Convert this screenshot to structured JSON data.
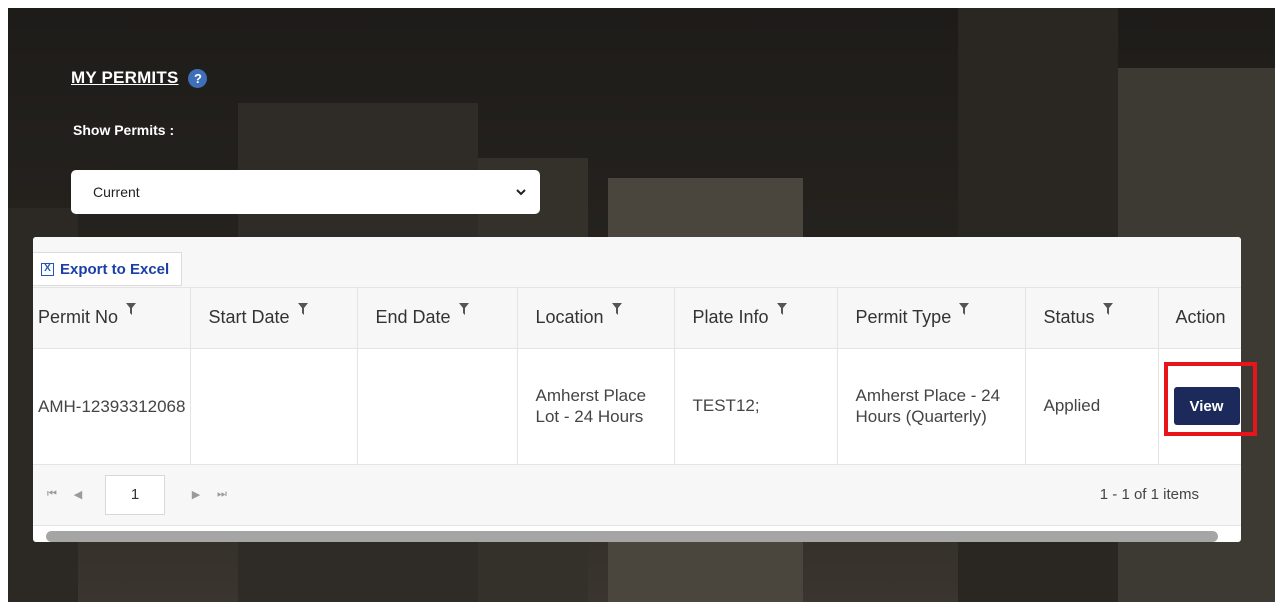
{
  "page": {
    "title": "MY PERMITS",
    "help_icon": "question-icon",
    "help_glyph": "?",
    "show_label": "Show Permits :",
    "filter_value": "Current"
  },
  "toolbar": {
    "export_label": "Export to Excel",
    "export_icon": "excel-icon",
    "export_glyph": "X"
  },
  "table": {
    "columns": [
      "Permit No",
      "Start Date",
      "End Date",
      "Location",
      "Plate Info",
      "Permit Type",
      "Status",
      "Action"
    ],
    "rows": [
      {
        "permit_no": "AMH-12393312068",
        "start_date": "",
        "end_date": "",
        "location": "Amherst Place Lot - 24 Hours",
        "plate_info": "TEST12;",
        "permit_type": "Amherst Place - 24 Hours (Quarterly)",
        "status": "Applied",
        "action_label": "View"
      }
    ]
  },
  "pager": {
    "first_glyph": "⏮",
    "prev_glyph": "◀",
    "next_glyph": "▶",
    "last_glyph": "⏭",
    "current_page": "1",
    "items_info": "1 - 1 of 1 items"
  },
  "colors": {
    "accent": "#1c2a5b",
    "link": "#1a3fa6",
    "highlight": "#e8141b"
  }
}
